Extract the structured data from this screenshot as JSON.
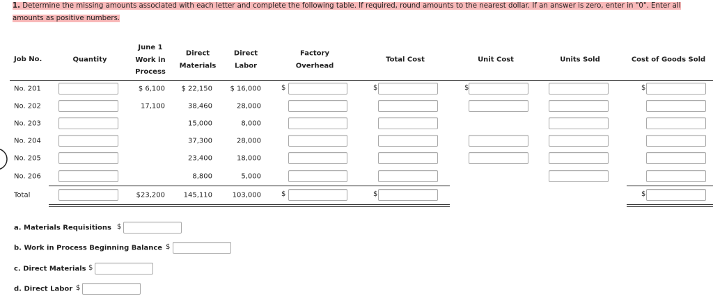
{
  "instructions": {
    "number": "1.",
    "line1": "Determine the missing amounts associated with each letter and complete the following table. If required, round amounts to the nearest dollar. If an answer is zero, enter in \"0\". Enter all",
    "line2": "amounts as positive numbers."
  },
  "headers": {
    "job_no": "Job No.",
    "quantity": "Quantity",
    "wip": [
      "June 1",
      "Work in",
      "Process"
    ],
    "dm": [
      "Direct",
      "Materials"
    ],
    "dl": [
      "Direct",
      "Labor"
    ],
    "fo": [
      "Factory",
      "Overhead"
    ],
    "total_cost": "Total Cost",
    "unit_cost": "Unit Cost",
    "units_sold": "Units Sold",
    "cogs": "Cost of Goods Sold"
  },
  "rows": [
    {
      "job": "No. 201",
      "wip": "$ 6,100",
      "dm": "$ 22,150",
      "dl": "$ 16,000"
    },
    {
      "job": "No. 202",
      "wip": "17,100",
      "dm": "38,460",
      "dl": "28,000"
    },
    {
      "job": "No. 203",
      "wip": "",
      "dm": "15,000",
      "dl": "8,000"
    },
    {
      "job": "No. 204",
      "wip": "",
      "dm": "37,300",
      "dl": "28,000"
    },
    {
      "job": "No. 205",
      "wip": "",
      "dm": "23,400",
      "dl": "18,000"
    },
    {
      "job": "No. 206",
      "wip": "",
      "dm": "8,800",
      "dl": "5,000"
    },
    {
      "job": "Total",
      "wip": "$23,200",
      "dm": "145,110",
      "dl": "103,000"
    }
  ],
  "currency_symbol": "$",
  "questions": [
    {
      "label": "a. Materials Requisitions",
      "value": ""
    },
    {
      "label": "b. Work in Process Beginning Balance",
      "value": ""
    },
    {
      "label": "c. Direct Materials",
      "value": ""
    },
    {
      "label": "d. Direct Labor",
      "value": ""
    }
  ]
}
